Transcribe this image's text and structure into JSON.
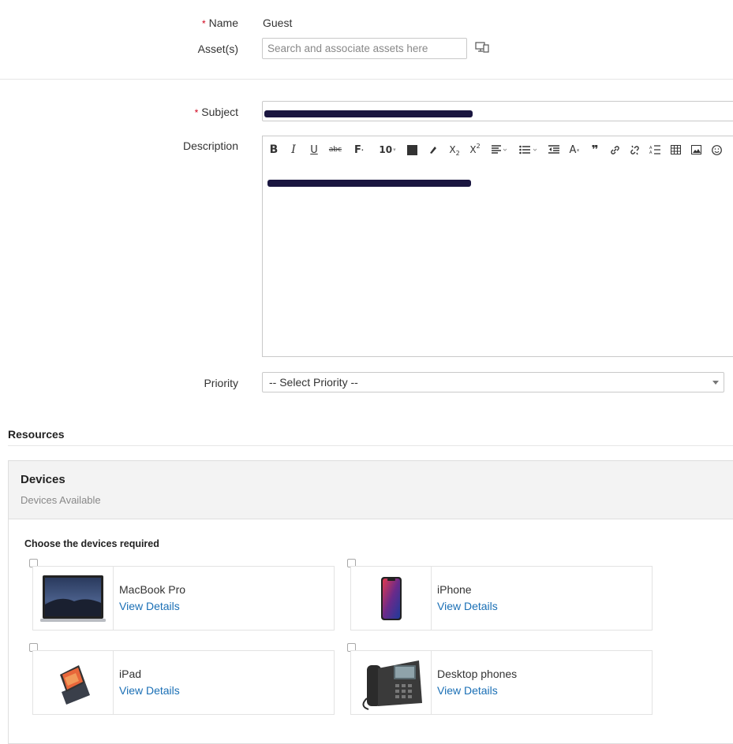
{
  "form": {
    "name_label": "Name",
    "name_value": "Guest",
    "assets_label": "Asset(s)",
    "assets_placeholder": "Search and associate assets here",
    "subject_label": "Subject",
    "description_label": "Description",
    "priority_label": "Priority",
    "priority_selected": "-- Select Priority --",
    "required_mark": "*"
  },
  "toolbar": {
    "font_size": "10"
  },
  "resources": {
    "heading": "Resources",
    "panel_title": "Devices",
    "panel_subtitle": "Devices Available",
    "choose_label": "Choose the devices required",
    "devices": [
      {
        "name": "MacBook Pro",
        "link": "View Details"
      },
      {
        "name": "iPhone",
        "link": "View Details"
      },
      {
        "name": "iPad",
        "link": "View Details"
      },
      {
        "name": "Desktop phones",
        "link": "View Details"
      }
    ]
  },
  "colors": {
    "required": "#d0021b",
    "link": "#1a6fb5",
    "redaction": "#1a1640"
  }
}
